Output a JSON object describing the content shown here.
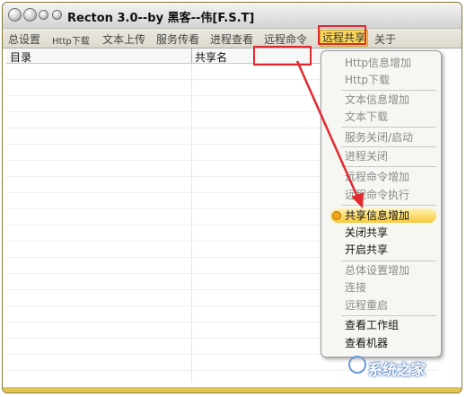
{
  "window": {
    "title": "Recton 3.0--by 黑客--伟[F.S.T]"
  },
  "menu": [
    {
      "label": "总设置"
    },
    {
      "label": "Http下载"
    },
    {
      "label": "文本上传"
    },
    {
      "label": "服务传看"
    },
    {
      "label": "进程查看"
    },
    {
      "label": "远程命令"
    },
    {
      "label": "远程共享"
    },
    {
      "label": "关于"
    }
  ],
  "table": {
    "columns": [
      "目录",
      "共享名"
    ]
  },
  "context_menu": {
    "items": [
      {
        "label": "Http信息增加",
        "enabled": false
      },
      {
        "label": "Http下载",
        "enabled": false
      },
      {
        "label": "文本信息增加",
        "enabled": false
      },
      {
        "label": "文本下载",
        "enabled": false
      },
      {
        "label": "服务关闭/启动",
        "enabled": false
      },
      {
        "label": "进程关闭",
        "enabled": false
      },
      {
        "label": "远程命令增加",
        "enabled": false
      },
      {
        "label": "远程命令执行",
        "enabled": false
      },
      {
        "label": "共享信息增加",
        "enabled": true,
        "selected": true
      },
      {
        "label": "关闭共享",
        "enabled": true
      },
      {
        "label": "开启共享",
        "enabled": true
      },
      {
        "label": "总体设置增加",
        "enabled": false
      },
      {
        "label": "连接",
        "enabled": false
      },
      {
        "label": "远程重启",
        "enabled": false
      },
      {
        "label": "查看工作组",
        "enabled": true
      },
      {
        "label": "查看机器",
        "enabled": true
      }
    ]
  },
  "watermark": "系统之家",
  "colors": {
    "annotation_red": "#e02a30",
    "highlight_yellow": "#fcd85a",
    "bottom_bar": "#e3c44f"
  }
}
